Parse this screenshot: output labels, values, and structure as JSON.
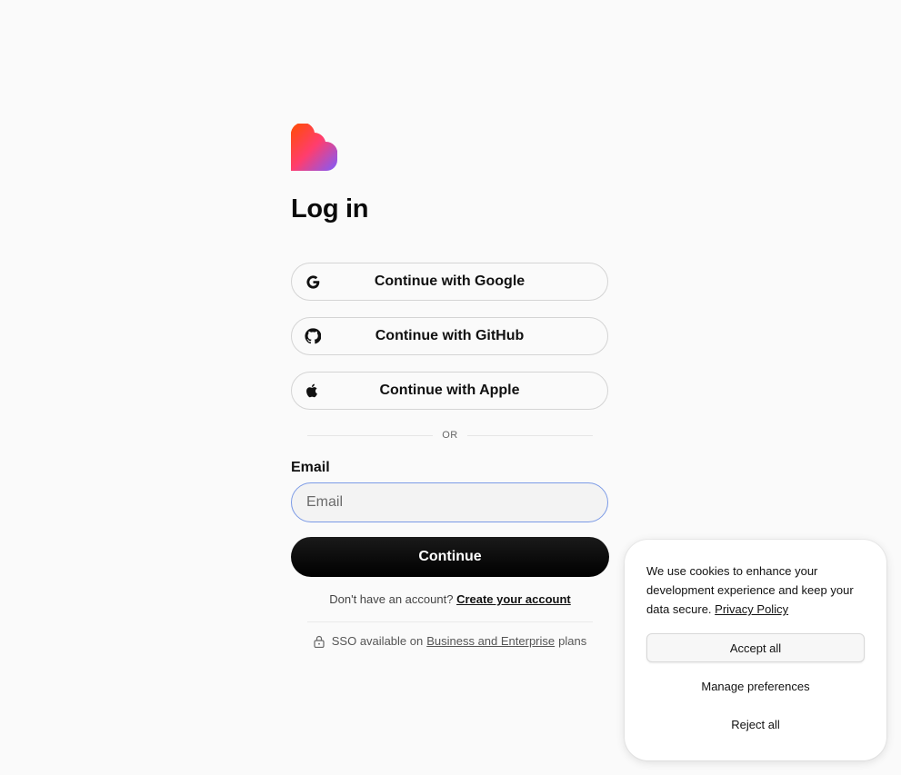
{
  "login": {
    "title": "Log in",
    "oauth": [
      {
        "label": "Continue with Google",
        "icon": "google-icon"
      },
      {
        "label": "Continue with GitHub",
        "icon": "github-icon"
      },
      {
        "label": "Continue with Apple",
        "icon": "apple-icon"
      }
    ],
    "divider_text": "OR",
    "email_label": "Email",
    "email_placeholder": "Email",
    "email_value": "",
    "continue_label": "Continue",
    "signup_prompt": "Don't have an account?",
    "signup_link": "Create your account",
    "sso_prefix": "SSO available on",
    "sso_link": "Business and Enterprise",
    "sso_suffix": "plans"
  },
  "cookie_banner": {
    "message": "We use cookies to enhance your development experience and keep your data secure.",
    "privacy_link": "Privacy Policy",
    "accept_label": "Accept all",
    "manage_label": "Manage preferences",
    "reject_label": "Reject all"
  },
  "colors": {
    "background": "#fafafa",
    "logo_gradient_start": "#ff5a1f",
    "logo_gradient_end": "#8a5cf6",
    "input_focus_border": "#7b9ae6",
    "primary_button": "#000000"
  }
}
